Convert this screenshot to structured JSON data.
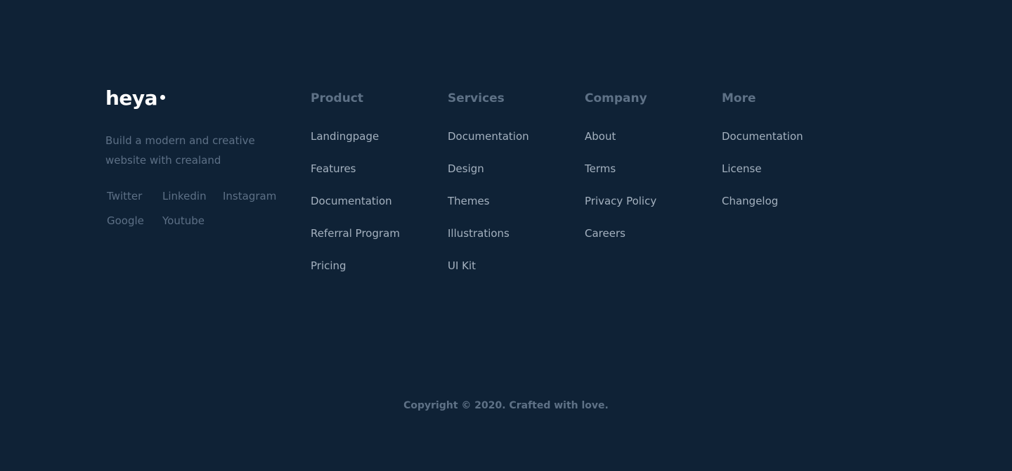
{
  "brand": {
    "logo_text": "heya",
    "tagline": "Build a modern and creative website with crealand",
    "social_links": [
      {
        "label": "Twitter"
      },
      {
        "label": "Linkedin"
      },
      {
        "label": "Instagram"
      },
      {
        "label": "Google"
      },
      {
        "label": "Youtube"
      }
    ]
  },
  "columns": [
    {
      "title": "Product",
      "links": [
        "Landingpage",
        "Features",
        "Documentation",
        "Referral Program",
        "Pricing"
      ]
    },
    {
      "title": "Services",
      "links": [
        "Documentation",
        "Design",
        "Themes",
        "Illustrations",
        "UI Kit"
      ]
    },
    {
      "title": "Company",
      "links": [
        "About",
        "Terms",
        "Privacy Policy",
        "Careers"
      ]
    },
    {
      "title": "More",
      "links": [
        "Documentation",
        "License",
        "Changelog"
      ]
    }
  ],
  "copyright": "Copyright © 2020. Crafted with love.",
  "colors": {
    "background": "#0f2236",
    "heading": "#5e7186",
    "link": "#a4b1bf",
    "muted": "#5d7086",
    "logo": "#ffffff"
  }
}
